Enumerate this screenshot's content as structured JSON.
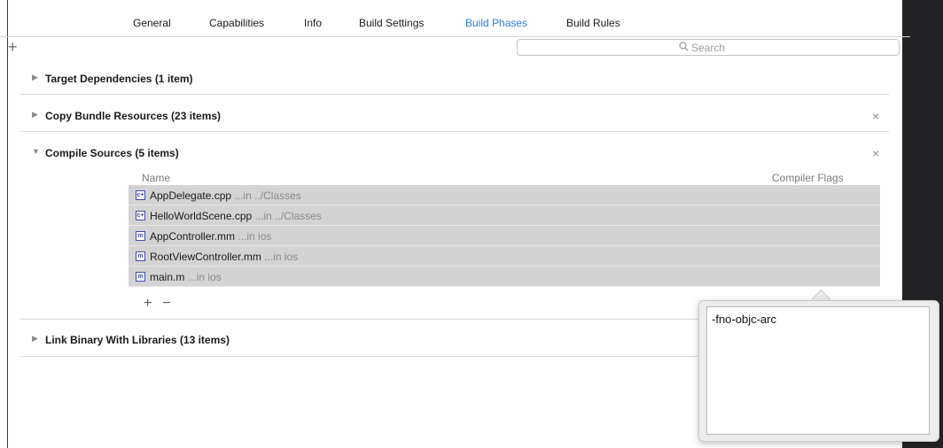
{
  "tabs": [
    {
      "label": "General",
      "active": false
    },
    {
      "label": "Capabilities",
      "active": false
    },
    {
      "label": "Info",
      "active": false
    },
    {
      "label": "Build Settings",
      "active": false
    },
    {
      "label": "Build Phases",
      "active": true
    },
    {
      "label": "Build Rules",
      "active": false
    }
  ],
  "toolbar": {
    "add_symbol": "+",
    "search_placeholder": "Search",
    "search_icon": "search-icon"
  },
  "phases": {
    "target_dependencies": {
      "title": "Target Dependencies (1 item)",
      "expanded": false
    },
    "copy_bundle_resources": {
      "title": "Copy Bundle Resources (23 items)",
      "expanded": false,
      "remove_symbol": "×"
    },
    "compile_sources": {
      "title": "Compile Sources (5 items)",
      "expanded": true,
      "remove_symbol": "×",
      "columns": {
        "name": "Name",
        "flags": "Compiler Flags"
      },
      "files": [
        {
          "icon": "cpp-file-icon",
          "icon_text": "c+",
          "name": "AppDelegate.cpp",
          "location": " ...in ../Classes"
        },
        {
          "icon": "cpp-file-icon",
          "icon_text": "c+",
          "name": "HelloWorldScene.cpp",
          "location": " ...in ../Classes"
        },
        {
          "icon": "objc-file-icon",
          "icon_text": "m",
          "name": "AppController.mm",
          "location": " ...in ios"
        },
        {
          "icon": "objc-file-icon",
          "icon_text": "m",
          "name": "RootViewController.mm",
          "location": " ...in ios"
        },
        {
          "icon": "objc-file-icon",
          "icon_text": "m",
          "name": "main.m",
          "location": " ...in ios"
        }
      ],
      "add_symbol": "+",
      "remove_file_symbol": "−"
    },
    "link_binary": {
      "title": "Link Binary With Libraries (13 items)",
      "expanded": false
    }
  },
  "disclosure": {
    "collapsed": "▶",
    "expanded": "▼"
  },
  "flags_popover": {
    "value": "-fno-objc-arc"
  },
  "colors": {
    "accent": "#2a7ee0",
    "selected_row": "#d3d3d3",
    "dark_panel": "#242426"
  }
}
